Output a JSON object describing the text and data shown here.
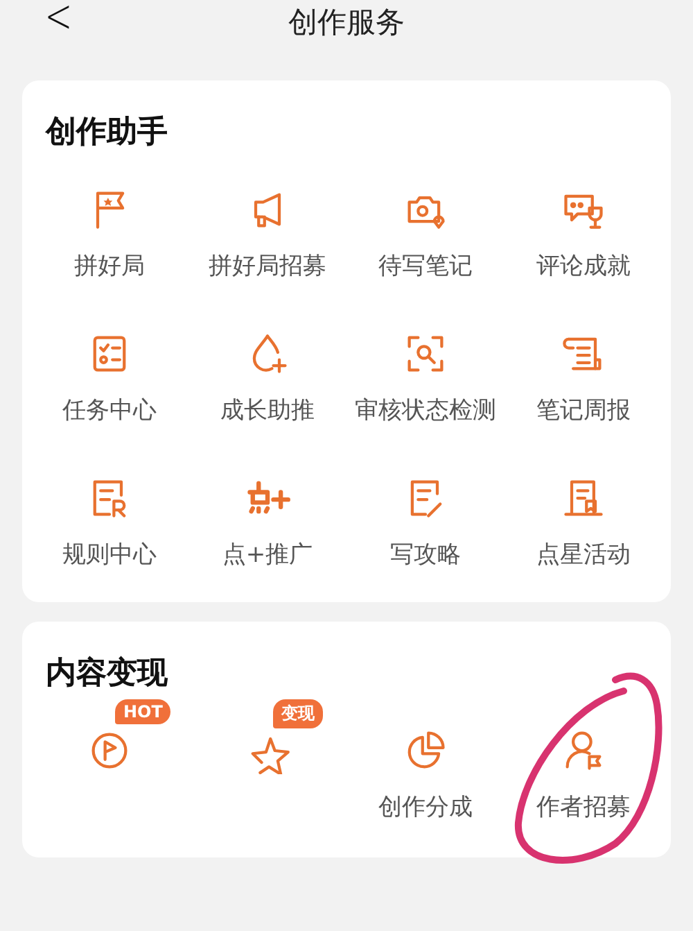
{
  "header": {
    "back": "<",
    "title": "创作服务"
  },
  "sections": [
    {
      "title": "创作助手",
      "items": [
        {
          "label": "拼好局"
        },
        {
          "label": "拼好局招募"
        },
        {
          "label": "待写笔记"
        },
        {
          "label": "评论成就"
        },
        {
          "label": "任务中心"
        },
        {
          "label": "成长助推"
        },
        {
          "label": "审核状态检测"
        },
        {
          "label": "笔记周报"
        },
        {
          "label": "规则中心"
        },
        {
          "label": "点+推广"
        },
        {
          "label": "写攻略"
        },
        {
          "label": "点星活动"
        }
      ]
    },
    {
      "title": "内容变现",
      "items": [
        {
          "badge": "HOT",
          "circled": false
        },
        {
          "badge": "变现",
          "circled": false
        },
        {
          "label": "创作分成",
          "circled": false
        },
        {
          "label": "作者招募",
          "circled": true
        }
      ]
    }
  ]
}
